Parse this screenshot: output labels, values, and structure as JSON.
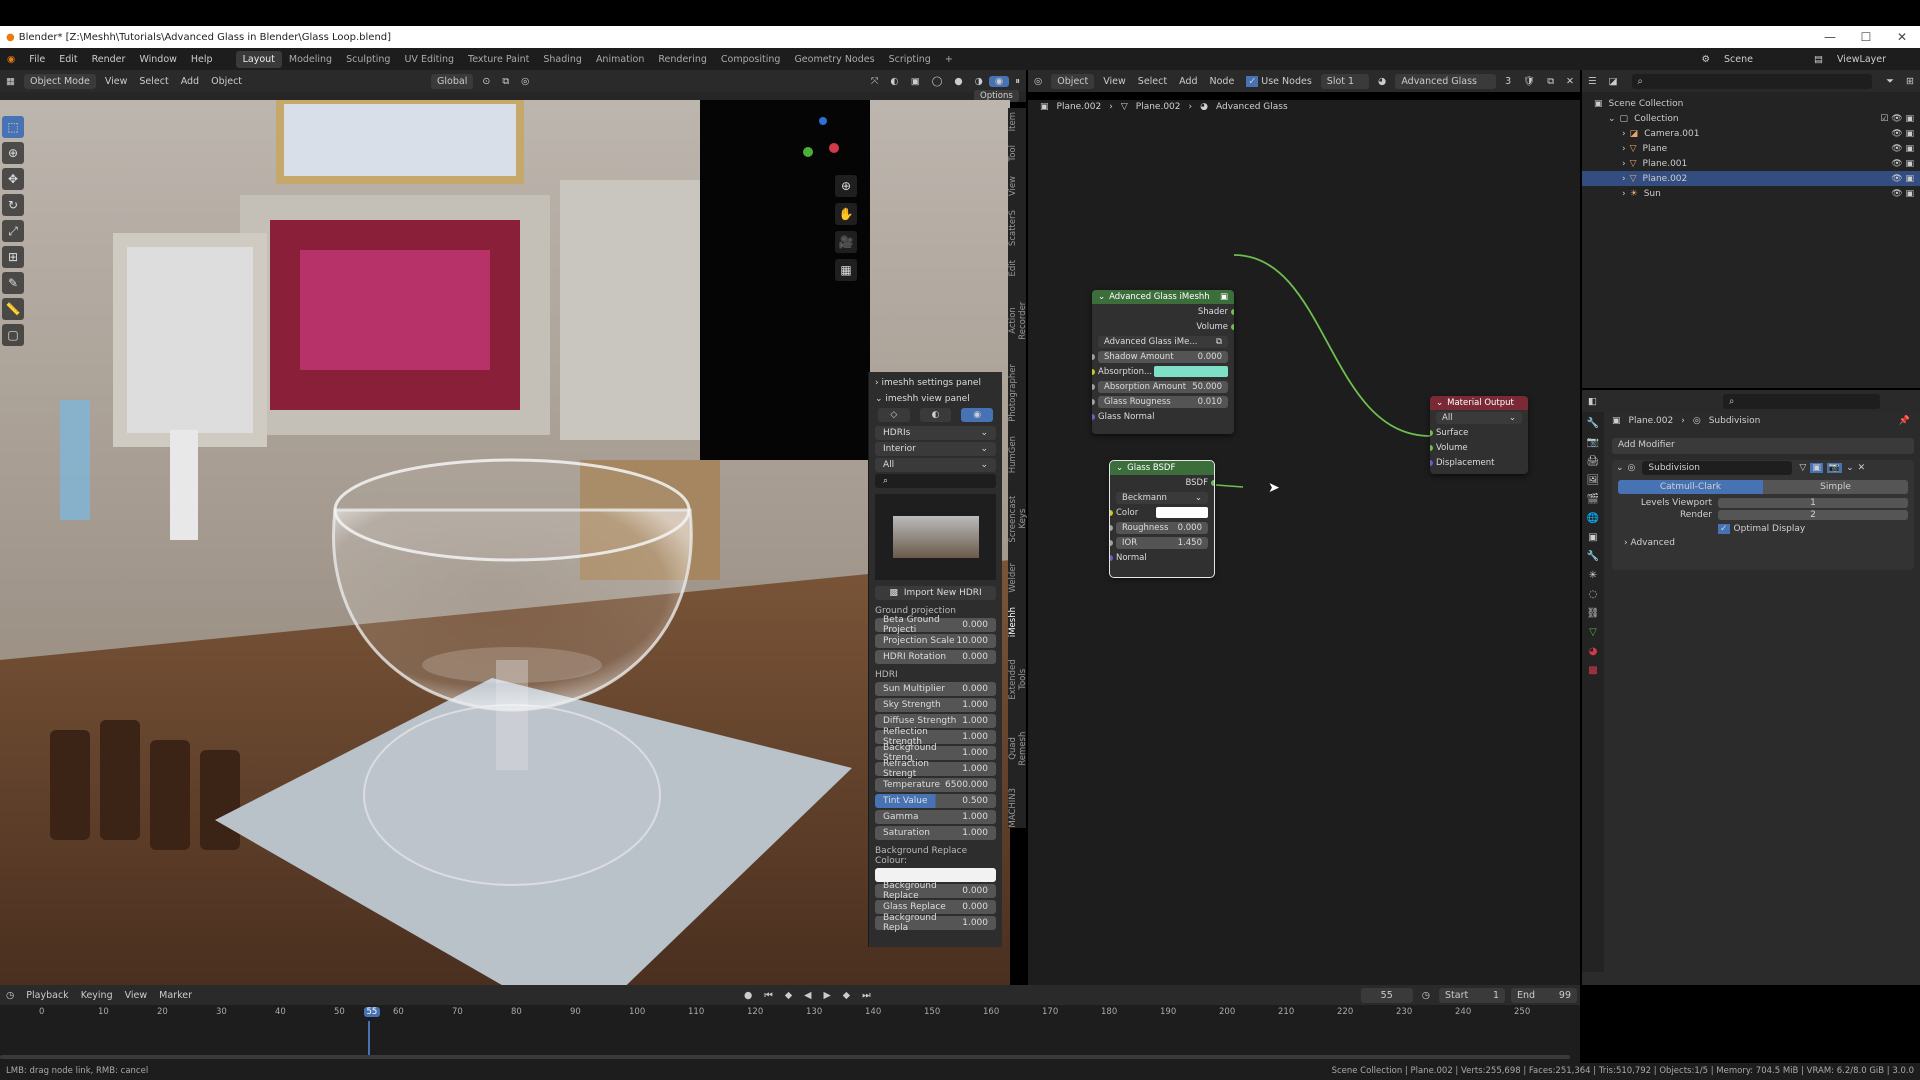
{
  "window": {
    "title": "Blender* [Z:\\Meshh\\Tutorials\\Advanced Glass in Blender\\Glass Loop.blend]"
  },
  "menu": {
    "items": [
      "File",
      "Edit",
      "Render",
      "Window",
      "Help"
    ],
    "workspaces": [
      "Layout",
      "Modeling",
      "Sculpting",
      "UV Editing",
      "Texture Paint",
      "Shading",
      "Animation",
      "Rendering",
      "Compositing",
      "Geometry Nodes",
      "Scripting"
    ],
    "add_workspace": "+",
    "scene": "Scene",
    "view_layer": "ViewLayer"
  },
  "viewport_header": {
    "mode": "Object Mode",
    "view": "View",
    "select": "Select",
    "add": "Add",
    "object": "Object",
    "orientation": "Global",
    "options": "Options"
  },
  "npanel": {
    "settings_panel": "imeshh settings panel",
    "view_panel": "imeshh view panel",
    "category": "HDRIs",
    "subcategory": "Interior",
    "filter": "All",
    "import_btn": "Import New HDRI",
    "ground_label": "Ground projection",
    "ground_rows": [
      {
        "label": "Beta Ground Projecti",
        "value": "0.000"
      },
      {
        "label": "Projection Scale",
        "value": "10.000"
      },
      {
        "label": "HDRI Rotation",
        "value": "0.000"
      }
    ],
    "hdri_label": "HDRI",
    "hdri_rows": [
      {
        "label": "Sun Multiplier",
        "value": "0.000"
      },
      {
        "label": "Sky Strength",
        "value": "1.000"
      },
      {
        "label": "Diffuse Strength",
        "value": "1.000"
      },
      {
        "label": "Reflection Strength",
        "value": "1.000"
      },
      {
        "label": "Background Streng",
        "value": "1.000"
      },
      {
        "label": "Refraction Strengt",
        "value": "1.000"
      },
      {
        "label": "Temperature",
        "value": "6500.000"
      },
      {
        "label": "Tint Value",
        "value": "0.500"
      },
      {
        "label": "Gamma",
        "value": "1.000"
      },
      {
        "label": "Saturation",
        "value": "1.000"
      }
    ],
    "bg_replace_label": "Background Replace Colour:",
    "bottom_rows": [
      {
        "label": "Background Replace",
        "value": "0.000"
      },
      {
        "label": "Glass Replace",
        "value": "0.000"
      },
      {
        "label": "Background Repla",
        "value": "1.000"
      }
    ],
    "vertical_tabs": [
      "Item",
      "Tool",
      "View",
      "ScatterS",
      "Edit",
      "Action Recorder",
      "Photographer",
      "HumGen",
      "Screencast Keys",
      "Welder",
      "iMeshh",
      "Extended Tools",
      "Quad Remesh",
      "MACHIN3"
    ]
  },
  "node_header": {
    "object": "Object",
    "view": "View",
    "select": "Select",
    "add": "Add",
    "node": "Node",
    "use_nodes": "Use Nodes",
    "slot": "Slot 1",
    "material": "Advanced Glass",
    "users": "3"
  },
  "breadcrumb": [
    "Plane.002",
    "Plane.002",
    "Advanced Glass"
  ],
  "nodes": {
    "group": {
      "title": "Advanced Glass iMeshh",
      "outputs": [
        "Shader",
        "Volume"
      ],
      "datablock": "Advanced Glass iMe...",
      "shadow_label": "Shadow Amount",
      "shadow_value": "0.000",
      "absorption_label": "Absorption...",
      "absorption_color": "#7fe0c8",
      "abs_amount_label": "Absorption Amount",
      "abs_amount_value": "50.000",
      "rough_label": "Glass Rougness",
      "rough_value": "0.010",
      "normal_label": "Glass Normal"
    },
    "glass": {
      "title": "Glass BSDF",
      "output": "BSDF",
      "distribution": "Beckmann",
      "color_label": "Color",
      "rough_label": "Roughness",
      "rough_value": "0.000",
      "ior_label": "IOR",
      "ior_value": "1.450",
      "normal_label": "Normal"
    },
    "output": {
      "title": "Material Output",
      "target": "All",
      "inputs": [
        "Surface",
        "Volume",
        "Displacement"
      ]
    }
  },
  "outliner": {
    "root": "Scene Collection",
    "collection": "Collection",
    "items": [
      "Camera.001",
      "Plane",
      "Plane.001",
      "Plane.002",
      "Sun"
    ]
  },
  "properties": {
    "object": "Plane.002",
    "modifier_crumb": "Subdivision",
    "add_modifier": "Add Modifier",
    "modifier_name": "Subdivision",
    "mode_a": "Catmull-Clark",
    "mode_b": "Simple",
    "levels_label": "Levels Viewport",
    "levels_value": "1",
    "render_label": "Render",
    "render_value": "2",
    "optimal": "Optimal Display",
    "advanced": "Advanced"
  },
  "timeline": {
    "playback": "Playback",
    "keying": "Keying",
    "view": "View",
    "marker": "Marker",
    "current_frame": "55",
    "start_label": "Start",
    "start": "1",
    "end_label": "End",
    "end": "99",
    "ticks": [
      "0",
      "10",
      "20",
      "30",
      "40",
      "50",
      "55",
      "60",
      "70",
      "80",
      "90",
      "100",
      "110",
      "120",
      "130",
      "140",
      "150",
      "160",
      "170",
      "180",
      "190",
      "200",
      "210",
      "220",
      "230",
      "240",
      "250"
    ]
  },
  "status": {
    "left": "LMB: drag node link, RMB: cancel",
    "right": "Scene Collection | Plane.002 | Verts:255,698 | Faces:251,364 | Tris:510,792 | Objects:1/5 | Memory: 704.5 MiB | VRAM: 6.2/8.0 GiB | 3.0.0"
  },
  "colors": {
    "accent": "#4772b3",
    "group_header": "#3c6e3c",
    "output_header": "#7a2a35",
    "link": "#6fbf4f"
  }
}
